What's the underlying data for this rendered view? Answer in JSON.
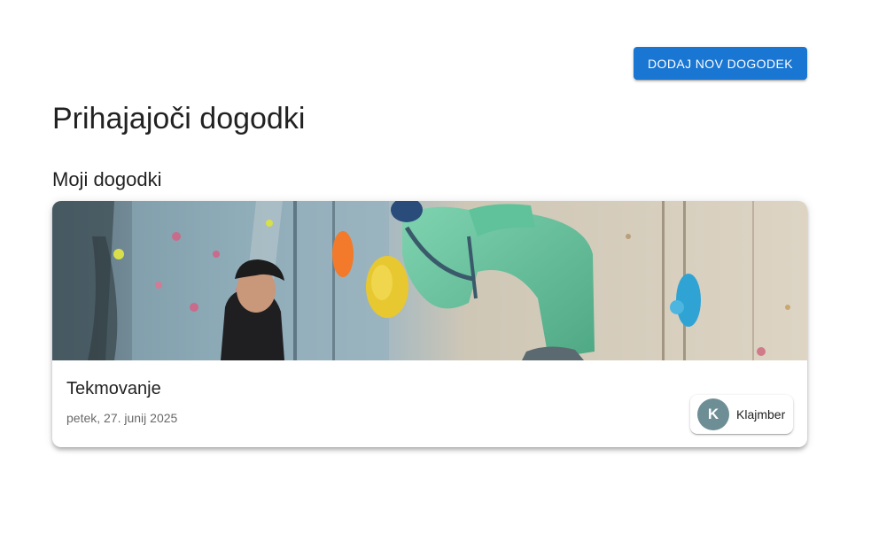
{
  "header": {
    "add_event_button": "DODAJ NOV DOGODEK",
    "page_title": "Prihajajoči dogodki"
  },
  "my_events": {
    "section_title": "Moji dogodki",
    "events": [
      {
        "title": "Tekmovanje",
        "date": "petek, 27. junij 2025",
        "image_description": "climbing-wall-photo",
        "organizer": {
          "avatar_initial": "K",
          "name": "Klajmber"
        }
      }
    ]
  },
  "colors": {
    "primary": "#1976d2",
    "avatar": "#6e8e96"
  }
}
